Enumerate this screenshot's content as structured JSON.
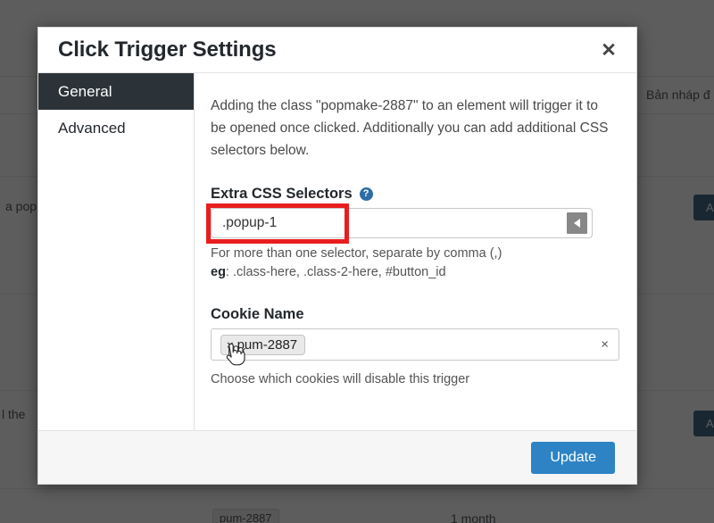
{
  "background": {
    "column_header": "Bản nháp đ",
    "rows": [
      {
        "text": "a pop"
      },
      {
        "text": "l the "
      }
    ],
    "buttons": [
      {
        "label": "A"
      },
      {
        "label": "A"
      }
    ],
    "bottom_row": {
      "cookie_tag": "pum-2887",
      "duration": "1 month"
    },
    "overlay_color": "#1e1e1e"
  },
  "modal": {
    "title": "Click Trigger Settings",
    "close_label": "✕",
    "tabs": [
      {
        "label": "General",
        "active": true
      },
      {
        "label": "Advanced",
        "active": false
      }
    ],
    "intro_text": "Adding the class \"popmake-2887\" to an element will trigger it to be opened once clicked. Additionally you can add additional CSS selectors below.",
    "extra_css_selectors": {
      "label": "Extra CSS Selectors",
      "help_icon": "?",
      "value": ".popup-1",
      "placeholder": "",
      "arrow_icon": "caret-left-icon",
      "hint_line1": "For more than one selector, separate by comma (,)",
      "hint_prefix": "eg",
      "hint_line2": ": .class-here, .class-2-here, #button_id",
      "highlight_color": "#e81e1e"
    },
    "cookie_name": {
      "label": "Cookie Name",
      "tag": "pum-2887",
      "tag_remove": "×",
      "clear_all": "×",
      "hint": "Choose which cookies will disable this trigger"
    },
    "footer": {
      "update_label": "Update",
      "accent_color": "#2e83c4"
    }
  }
}
